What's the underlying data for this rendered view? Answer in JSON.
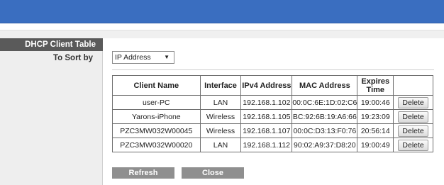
{
  "colors": {
    "topbar": "#3a6ec0",
    "section_header": "#5a5a5a",
    "button": "#8f8f8f"
  },
  "section": {
    "title": "DHCP Client Table"
  },
  "sort": {
    "label": "To Sort by",
    "selected": "IP Address",
    "arrow_icon": "triangle-down-icon"
  },
  "table": {
    "headers": [
      "Client Name",
      "Interface",
      "IPv4 Address",
      "MAC Address",
      "Expires Time",
      ""
    ],
    "rows": [
      {
        "name": "user-PC",
        "interface": "LAN",
        "ip": "192.168.1.102",
        "mac": "00:0C:6E:1D:02:C6",
        "expires": "19:00:46",
        "action": "Delete"
      },
      {
        "name": "Yarons-iPhone",
        "interface": "Wireless",
        "ip": "192.168.1.105",
        "mac": "BC:92:6B:19:A6:66",
        "expires": "19:23:09",
        "action": "Delete"
      },
      {
        "name": "PZC3MW032W00045",
        "interface": "Wireless",
        "ip": "192.168.1.107",
        "mac": "00:0C:D3:13:F0:76",
        "expires": "20:56:14",
        "action": "Delete"
      },
      {
        "name": "PZC3MW032W00020",
        "interface": "LAN",
        "ip": "192.168.1.112",
        "mac": "90:02:A9:37:D8:20",
        "expires": "19:00:49",
        "action": "Delete"
      }
    ]
  },
  "buttons": {
    "refresh": "Refresh",
    "close": "Close"
  }
}
